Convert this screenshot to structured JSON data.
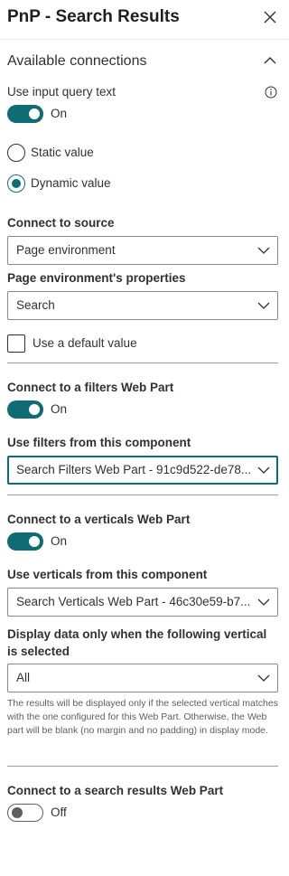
{
  "panel": {
    "title": "PnP - Search Results"
  },
  "section": {
    "title": "Available connections"
  },
  "query_text": {
    "label": "Use input query text",
    "toggle_state": "On"
  },
  "value_type": {
    "options": [
      "Static value",
      "Dynamic value"
    ],
    "selected": "Dynamic value"
  },
  "source": {
    "label": "Connect to source",
    "value": "Page environment"
  },
  "properties": {
    "label": "Page environment's properties",
    "value": "Search"
  },
  "default_value": {
    "label": "Use a default value",
    "checked": false
  },
  "filters": {
    "label": "Connect to a filters Web Part",
    "toggle_state": "On",
    "component_label": "Use filters from this component",
    "component_value": "Search Filters Web Part - 91c9d522-de78..."
  },
  "verticals": {
    "label": "Connect to a verticals Web Part",
    "toggle_state": "On",
    "component_label": "Use verticals from this component",
    "component_value": "Search Verticals Web Part - 46c30e59-b7...",
    "display_label": "Display data only when the following vertical is selected",
    "display_value": "All",
    "note": "The results will be displayed only if the selected vertical matches with the one configured for this Web Part. Otherwise, the Web part will be blank (no margin and no padding) in display mode."
  },
  "search_results": {
    "label": "Connect to a search results Web Part",
    "toggle_state": "Off"
  },
  "colors": {
    "accent": "#0f6c74",
    "text": "#323130",
    "border": "#8a8886"
  },
  "icons": {
    "close": "close-icon",
    "collapse": "chevron-up-icon",
    "info": "info-icon",
    "dropdown": "chevron-down-icon"
  }
}
